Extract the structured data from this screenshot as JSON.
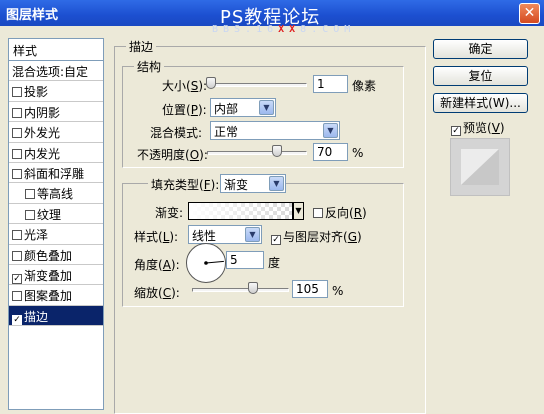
{
  "window": {
    "title": "图层样式",
    "watermark": "PS教程论坛",
    "watermark_sub_left": "BBS.16",
    "watermark_sub_red": "XX",
    "watermark_sub_right": "8.COM",
    "close_glyph": "✕"
  },
  "sidebar": {
    "header": "样式",
    "items": [
      {
        "label": "混合选项:自定",
        "checkbox": false,
        "checked": false,
        "indent": false,
        "selected": false
      },
      {
        "label": "投影",
        "checkbox": true,
        "checked": false,
        "indent": false,
        "selected": false
      },
      {
        "label": "内阴影",
        "checkbox": true,
        "checked": false,
        "indent": false,
        "selected": false
      },
      {
        "label": "外发光",
        "checkbox": true,
        "checked": false,
        "indent": false,
        "selected": false
      },
      {
        "label": "内发光",
        "checkbox": true,
        "checked": false,
        "indent": false,
        "selected": false
      },
      {
        "label": "斜面和浮雕",
        "checkbox": true,
        "checked": false,
        "indent": false,
        "selected": false
      },
      {
        "label": "等高线",
        "checkbox": true,
        "checked": false,
        "indent": true,
        "selected": false
      },
      {
        "label": "纹理",
        "checkbox": true,
        "checked": false,
        "indent": true,
        "selected": false
      },
      {
        "label": "光泽",
        "checkbox": true,
        "checked": false,
        "indent": false,
        "selected": false
      },
      {
        "label": "颜色叠加",
        "checkbox": true,
        "checked": false,
        "indent": false,
        "selected": false
      },
      {
        "label": "渐变叠加",
        "checkbox": true,
        "checked": true,
        "indent": false,
        "selected": false
      },
      {
        "label": "图案叠加",
        "checkbox": true,
        "checked": false,
        "indent": false,
        "selected": false
      },
      {
        "label": "描边",
        "checkbox": true,
        "checked": true,
        "indent": false,
        "selected": true
      }
    ]
  },
  "stroke": {
    "group_label": "描边",
    "structure": {
      "group_label": "结构",
      "size_label_pre": "大小(",
      "size_label_key": "S",
      "size_label_post": "):",
      "size_value": "1",
      "size_unit": "像素",
      "position_label_pre": "位置(",
      "position_label_key": "P",
      "position_label_post": "):",
      "position_value": "内部",
      "blend_label_pre": "混合模式",
      "blend_label_key": "",
      "blend_label_post": ":",
      "blend_value": "正常",
      "opacity_label_pre": "不透明度(",
      "opacity_label_key": "O",
      "opacity_label_post": "):",
      "opacity_value": "70",
      "opacity_unit": "%"
    },
    "fill": {
      "type_label_pre": "填充类型(",
      "type_label_key": "F",
      "type_label_post": "):",
      "type_value": "渐变",
      "gradient_label": "渐变:",
      "reverse_label_pre": "反向(",
      "reverse_label_key": "R",
      "reverse_label_post": ")",
      "reverse_checked": false,
      "style_label_pre": "样式(",
      "style_label_key": "L",
      "style_label_post": "):",
      "style_value": "线性",
      "align_label_pre": "与图层对齐(",
      "align_label_key": "G",
      "align_label_post": ")",
      "align_checked": true,
      "angle_label_pre": "角度(",
      "angle_label_key": "A",
      "angle_label_post": "):",
      "angle_value": "5",
      "angle_unit": "度",
      "scale_label_pre": "缩放(",
      "scale_label_key": "C",
      "scale_label_post": "):",
      "scale_value": "105",
      "scale_unit": "%"
    }
  },
  "buttons": {
    "ok": "确定",
    "reset": "复位",
    "new_style": "新建样式(W)...",
    "preview_label_pre": "预览(",
    "preview_label_key": "V",
    "preview_label_post": ")",
    "preview_checked": true
  },
  "colors": {
    "title_bar": "#1c4fd0",
    "selected_row": "#0a246a",
    "panel_bg": "#ece9d8",
    "watermark_red": "#e02020"
  }
}
